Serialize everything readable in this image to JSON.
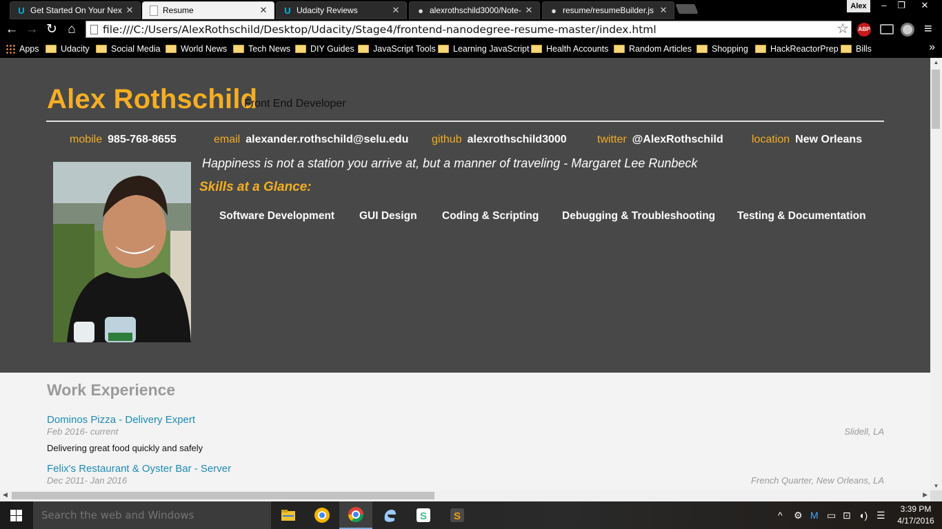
{
  "browser": {
    "tabs": [
      {
        "title": "Get Started On Your Next",
        "icon": "udacity-icon"
      },
      {
        "title": "Resume",
        "icon": "page-icon",
        "active": true
      },
      {
        "title": "Udacity Reviews",
        "icon": "udacity-icon"
      },
      {
        "title": "alexrothschild3000/Note-",
        "icon": "github-icon"
      },
      {
        "title": "resume/resumeBuilder.js a",
        "icon": "github-icon"
      }
    ],
    "profile_name": "Alex",
    "url": "file:///C:/Users/AlexRothschild/Desktop/Udacity/Stage4/frontend-nanodegree-resume-master/index.html",
    "extension_labels": {
      "adblock": "ABP"
    },
    "bookmarks": [
      "Apps",
      "Udacity",
      "Social Media",
      "World News",
      "Tech News",
      "DIY Guides",
      "JavaScript Tools",
      "Learning JavaScript",
      "Health Accounts",
      "Random Articles",
      "Shopping",
      "HackReactorPrep",
      "Bills"
    ],
    "bookmarks_more": "»"
  },
  "resume": {
    "name": "Alex Rothschild",
    "role": "Front End Developer",
    "contacts": [
      {
        "key": "mobile",
        "value": "985-768-8655"
      },
      {
        "key": "email",
        "value": "alexander.rothschild@selu.edu"
      },
      {
        "key": "github",
        "value": "alexrothschild3000"
      },
      {
        "key": "twitter",
        "value": "@AlexRothschild"
      },
      {
        "key": "location",
        "value": "New Orleans"
      }
    ],
    "quote": "Happiness is not a station you arrive at, but a manner of traveling - Margaret Lee Runbeck",
    "skills_title": "Skills at a Glance:",
    "skills": [
      "Software Development",
      "GUI Design",
      "Coding & Scripting",
      "Debugging & Troubleshooting",
      "Testing & Documentation"
    ],
    "work_title": "Work Experience",
    "jobs": [
      {
        "title": "Dominos Pizza - Delivery Expert",
        "dates": "Feb 2016- current",
        "location": "Slidell, LA",
        "description": "Delivering great food quickly and safely"
      },
      {
        "title": "Felix's Restaurant & Oyster Bar - Server",
        "dates": "Dec 2011- Jan 2016",
        "location": "French Quarter, New Orleans, LA",
        "description": ""
      }
    ]
  },
  "taskbar": {
    "search_placeholder": "Search the web and Windows",
    "time": "3:39 PM",
    "date": "4/17/2016",
    "apps": [
      "file-explorer-icon",
      "chrome-canary-icon",
      "chrome-icon",
      "edge-icon",
      "slack-icon",
      "sublime-text-icon"
    ]
  },
  "colors": {
    "accent": "#f5ae23",
    "header_bg": "#484848",
    "link": "#1c8cb8"
  }
}
